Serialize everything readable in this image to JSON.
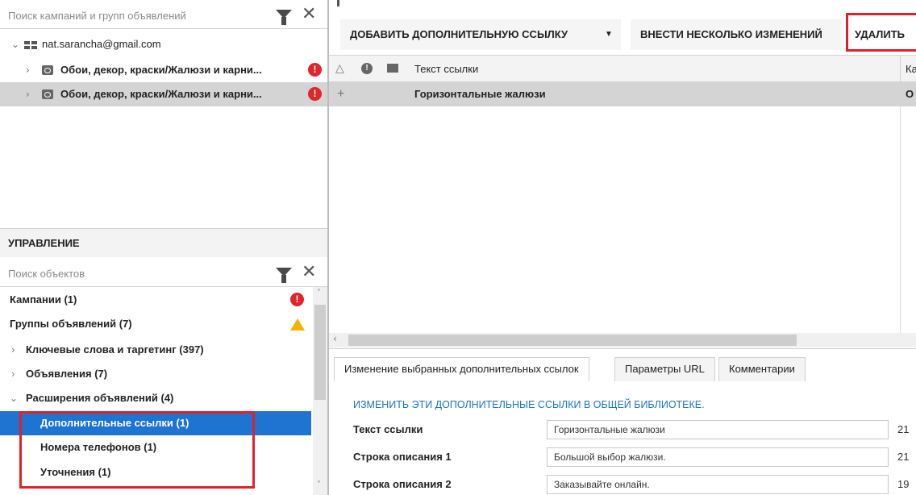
{
  "left_panel": {
    "search_placeholder": "Поиск кампаний и групп объявлений",
    "account": "nat.sarancha@gmail.com",
    "adgroups": [
      {
        "label": "Обои, декор, краски/Жалюзи и карни..."
      },
      {
        "label": "Обои, декор, краски/Жалюзи и карни..."
      }
    ]
  },
  "management": {
    "header": "УПРАВЛЕНИЕ",
    "search_placeholder": "Поиск объектов",
    "items": [
      {
        "label": "Кампании (1)"
      },
      {
        "label": "Группы объявлений (7)"
      },
      {
        "label": "Ключевые слова и таргетинг (397)"
      },
      {
        "label": "Объявления (7)"
      },
      {
        "label": "Расширения объявлений (4)"
      },
      {
        "label": "Дополнительные ссылки (1)"
      },
      {
        "label": "Номера телефонов (1)"
      },
      {
        "label": "Уточнения (1)"
      }
    ]
  },
  "toolbar": {
    "add_sitelink": "ДОБАВИТЬ ДОПОЛНИТЕЛЬНУЮ ССЫЛКУ",
    "multiple_changes": "ВНЕСТИ НЕСКОЛЬКО ИЗМЕНЕНИЙ",
    "delete": "УДАЛИТЬ"
  },
  "grid": {
    "columns": [
      "Текст ссылки",
      "Ка"
    ],
    "rows": [
      {
        "text": "Горизонтальные жалюзи",
        "extra": "О"
      }
    ]
  },
  "tabs": [
    {
      "label": "Изменение выбранных дополнительных ссылок"
    },
    {
      "label": "Параметры URL"
    },
    {
      "label": "Комментарии"
    }
  ],
  "form": {
    "library_link": "ИЗМЕНИТЬ ЭТИ ДОПОЛНИТЕЛЬНЫЕ ССЫЛКИ В ОБЩЕЙ БИБЛИОТЕКЕ.",
    "fields": [
      {
        "label": "Текст ссылки",
        "value": "Горизонтальные жалюзи",
        "count": "21"
      },
      {
        "label": "Строка описания 1",
        "value": "Большой выбор жалюзи.",
        "count": "21"
      },
      {
        "label": "Строка описания 2",
        "value": "Заказывайте онлайн.",
        "count": "19"
      }
    ]
  },
  "colors": {
    "accent": "#1a73c8",
    "selected": "#0e6fd1",
    "highlight_box": "#e0202a",
    "error": "#e0252b",
    "warning": "#f1b400"
  }
}
